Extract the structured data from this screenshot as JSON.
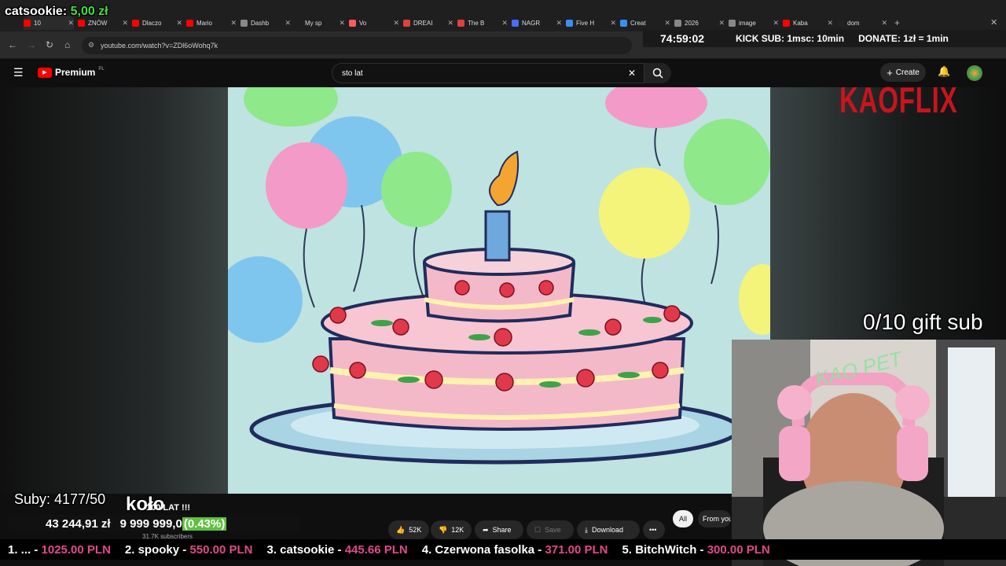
{
  "overlay": {
    "top_donor": "catsookie:",
    "top_donor_amount": "5,00 zł",
    "stream_timer": "74:59:02",
    "kick_sub": "KICK SUB: 1msc: 10min",
    "donate_rate": "DONATE: 1zł = 1min",
    "brand": "KAOFLIX",
    "gift_sub": "0/10 gift sub",
    "subs_counter": "Suby: 4177/50",
    "koło_text": "koło",
    "goal_amount": "43 244,91 zł",
    "goal_target": "9 999 999,0",
    "goal_percent": "(0.43%)",
    "video_title_partial": "100 LAT !!!",
    "channel_subs_partial": "31.7K subscribers",
    "ticker": [
      {
        "label": "1. ... - ",
        "amount": "1025.00 PLN"
      },
      {
        "label": "2. spooky - ",
        "amount": "550.00 PLN"
      },
      {
        "label": "3. catsookie - ",
        "amount": "445.66 PLN"
      },
      {
        "label": "4. Czerwona fasolka - ",
        "amount": "371.00 PLN"
      },
      {
        "label": "5. BitchWitch - ",
        "amount": "300.00 PLN"
      }
    ],
    "webcam_sign": "KAO PET"
  },
  "browser": {
    "tabs": [
      {
        "label": "10",
        "color": "#ff0000"
      },
      {
        "label": "ZNÓW",
        "color": "#ff0000"
      },
      {
        "label": "Dlaczo",
        "color": "#ff0000"
      },
      {
        "label": "Mario",
        "color": "#ff0000"
      },
      {
        "label": "Dashb",
        "color": "#888888"
      },
      {
        "label": "My sp",
        "color": "#1f1f1f"
      },
      {
        "label": "Vo",
        "color": "#ff5a5a"
      },
      {
        "label": "DREAI",
        "color": "#e04040"
      },
      {
        "label": "The B",
        "color": "#e04040"
      },
      {
        "label": "NAGR",
        "color": "#4a6cf7"
      },
      {
        "label": "Five H",
        "color": "#3a8ef0"
      },
      {
        "label": "Creat",
        "color": "#3a8ef0"
      },
      {
        "label": "2026",
        "color": "#888888"
      },
      {
        "label": "image",
        "color": "#888888"
      },
      {
        "label": "Kaba",
        "color": "#ff0000"
      },
      {
        "label": "dom",
        "color": "#222222"
      }
    ],
    "url": "youtube.com/watch?v=ZDl6oWohq7k"
  },
  "youtube": {
    "logo": "Premium",
    "region": "PL",
    "search_value": "sto lat",
    "create_label": "Create",
    "likes": "52K",
    "dislikes": "12K",
    "share_label": "Share",
    "save_label": "Save",
    "download_label": "Download",
    "chip_all": "All",
    "chip_from": "From you"
  }
}
